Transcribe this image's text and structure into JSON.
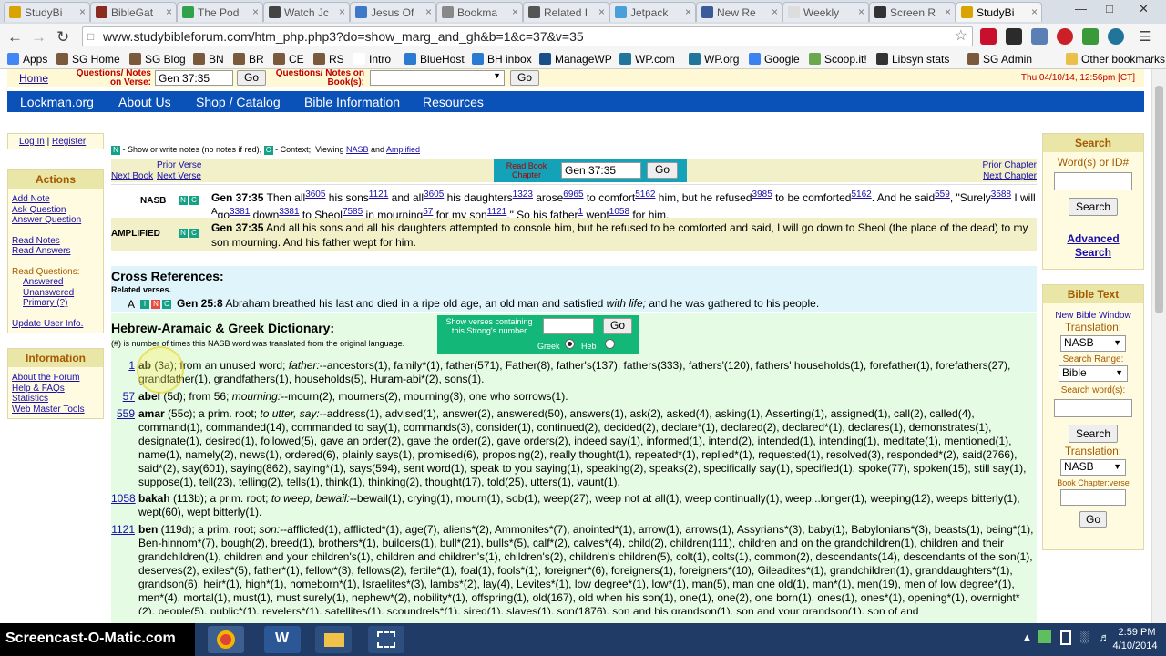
{
  "browser": {
    "tabs": [
      "StudyBi",
      "BibleGat",
      "The Pod",
      "Watch Jc",
      "Jesus Of",
      "Bookma",
      "Related I",
      "Jetpack",
      "New Re",
      "Weekly",
      "Screen R",
      "StudyBi"
    ],
    "tab_colors": [
      "#d9a400",
      "#8b2a1e",
      "#2fa24a",
      "#444444",
      "#3f78c8",
      "#888888",
      "#555555",
      "#4aa0d8",
      "#3a5a9a",
      "#dddddd",
      "#333333",
      "#d9a400"
    ],
    "url": "www.studybibleforum.com/htm_php.php3?do=show_marg_and_gh&b=1&c=37&v=35",
    "bookmarks": [
      "Apps",
      "SG Home",
      "SG Blog",
      "BN",
      "BR",
      "CE",
      "RS",
      "Intro",
      "BlueHost",
      "BH inbox",
      "ManageWP",
      "WP.com",
      "WP.org",
      "Google",
      "Scoop.it!",
      "Libsyn stats",
      "SG Admin",
      "Other bookmarks"
    ]
  },
  "topstrip": {
    "home": "Home",
    "q_notes_verse": "Questions/ Notes on Verse:",
    "verse_value": "Gen 37:35",
    "go": "Go",
    "q_notes_book": "Questions/ Notes on Book(s):",
    "datetime": "Thu 04/10/14, 12:56pm [CT]"
  },
  "nav": [
    "Lockman.org",
    "About Us",
    "Shop / Catalog",
    "Bible Information",
    "Resources"
  ],
  "login": {
    "login": "Log In",
    "sep": " | ",
    "register": "Register"
  },
  "actions": {
    "title": "Actions",
    "items": [
      "Add Note",
      "Ask Question",
      "Answer Question",
      "Read Notes",
      "Read Answers"
    ],
    "read_q": "Read Questions:",
    "sub": [
      "Answered",
      "Unanswered",
      "Primary (?)"
    ],
    "update": "Update User Info."
  },
  "information": {
    "title": "Information",
    "items": [
      "About the Forum",
      "Help & FAQs",
      "Statistics",
      "Web Master Tools"
    ]
  },
  "search": {
    "title": "Search",
    "label": "Word(s) or ID#",
    "button": "Search",
    "advanced1": "Advanced",
    "advanced2": "Search"
  },
  "bibletext": {
    "title": "Bible Text",
    "new_window": "New Bible Window",
    "translation_label": "Translation:",
    "translation": "NASB",
    "range_label": "Search Range:",
    "range": "Bible",
    "words_label": "Search word(s):",
    "search_btn": "Search",
    "translation2_label": "Translation:",
    "translation2": "NASB",
    "chapverse_label": "Book Chapter:verse",
    "go": "Go"
  },
  "legend": {
    "n": "N",
    "n_text": " - Show or write notes (no notes if red),",
    "c": "C",
    "c_text": " - Context;",
    "viewing": "Viewing ",
    "nasb": "NASB",
    "and": " and ",
    "amplified": "Amplified"
  },
  "chapnav": {
    "prior_verse": "Prior Verse",
    "next_book": "Next Book",
    "next_verse": "Next Verse",
    "read_label": "Read Book Chapter",
    "value": "Gen 37:35",
    "go": "Go",
    "prior_chapter": "Prior Chapter",
    "next_chapter": "Next Chapter"
  },
  "verses": [
    {
      "version": "NASB",
      "html": "<b>Gen 37:35</b> Then all<sup class='lnk'>3605</sup> his sons<sup class='lnk'>1121</sup> and all<sup class='lnk'>3605</sup> his daughters<sup class='lnk'>1323</sup> arose<sup class='lnk'>6965</sup> to comfort<sup class='lnk'>5162</sup> him, but he refused<sup class='lnk'>3985</sup> to be comforted<sup class='lnk'>5162</sup>. And he said<sup class='lnk'>559</sup>, \"Surely<sup class='lnk'>3588</sup> I will <sup>A</sup>go<sup class='lnk'>3381</sup> down<sup class='lnk'>3381</sup> to Sheol<sup class='lnk'>7585</sup> in mourning<sup class='lnk'>57</sup> for my son<sup class='lnk'>1121</sup>.\" So his father<sup class='lnk'>1</sup> wept<sup class='lnk'>1058</sup> for him."
    },
    {
      "version": "AMPLIFIED",
      "html": "<b>Gen 37:35</b> And all his sons and all his daughters attempted to console him, but he refused to be comforted and said, I will go down to Sheol (the place of the dead) to my son mourning. And his father wept for him."
    }
  ],
  "crossrefs": {
    "title": "Cross References:",
    "sub": "Related verses.",
    "letter": "A",
    "html": "<b>Gen 25:8</b> Abraham breathed his last and died in a ripe old age, an old man and satisfied <i>with life;</i> and he was gathered to his people."
  },
  "dictionary": {
    "title": "Hebrew-Aramaic & Greek Dictionary:",
    "sub": "(#) is number of times this NASB word was translated from the original language.",
    "show_label": "Show verses containing this Strong's number",
    "go": "Go",
    "greek": "Greek",
    "heb": "Heb",
    "entries": [
      {
        "num": "1",
        "html": "<b>ab</b> (3a); from an unused word; <i>father:</i>--ancestors(1), family*(1), father(571), Father(8), father's(137), fathers(333), fathers'(120), fathers' households(1), forefather(1), forefathers(27), grandfather(1), grandfathers(1), households(5), Huram-abi*(2), sons(1)."
      },
      {
        "num": "57",
        "html": "<b>abel</b> (5d); from 56; <i>mourning:</i>--mourn(2), mourners(2), mourning(3), one who sorrows(1)."
      },
      {
        "num": "559",
        "html": "<b>amar</b> (55c); a prim. root; <i>to utter, say:</i>--address(1), advised(1), answer(2), answered(50), answers(1), ask(2), asked(4), asking(1), Asserting(1), assigned(1), call(2), called(4), command(1), commanded(14), commanded to say(1), commands(3), consider(1), continued(2), decided(2), declare*(1), declared(2), declared*(1), declares(1), demonstrates(1), designate(1), desired(1), followed(5), gave an order(2), gave the order(2), gave orders(2), indeed say(1), informed(1), intend(2), intended(1), intending(1), meditate(1), mentioned(1), name(1), namely(2), news(1), ordered(6), plainly says(1), promised(6), proposing(2), really thought(1), repeated*(1), replied*(1), requested(1), resolved(3), responded*(2), said(2766), said*(2), say(601), saying(862), saying*(1), says(594), sent word(1), speak to you saying(1), speaking(2), speaks(2), specifically say(1), specified(1), spoke(77), spoken(15), still say(1), suppose(1), tell(23), telling(2), tells(1), think(1), thinking(2), thought(17), told(25), utters(1), vaunt(1)."
      },
      {
        "num": "1058",
        "html": "<b>bakah</b> (113b); a prim. root; <i>to weep, bewail:</i>--bewail(1), crying(1), mourn(1), sob(1), weep(27), weep not at all(1), weep continually(1), weep...longer(1), weeping(12), weeps bitterly(1), wept(60), wept bitterly(1)."
      },
      {
        "num": "1121",
        "html": "<b>ben</b> (119d); a prim. root; <i>son:</i>--afflicted(1), afflicted*(1), age(7), aliens*(2), Ammonites*(7), anointed*(1), arrow(1), arrows(1), Assyrians*(3), baby(1), Babylonians*(3), beasts(1), being*(1), Ben-hinnom*(7), bough(2), breed(1), brothers*(1), builders(1), bull*(21), bulls*(5), calf*(2), calves*(4), child(2), children(111), children and on the grandchildren(1), children and their grandchildren(1), children and your children's(1), children and children's(1), children's(2), children's children(5), colt(1), colts(1), common(2), descendants(14), descendants of the son(1), deserves(2), exiles*(5), father*(1), fellow*(3), fellows(2), fertile*(1), foal(1), fools*(1), foreigner*(6), foreigners(1), foreigners*(10), Gileadites*(1), grandchildren(1), granddaughters*(1), grandson(6), heir*(1), high*(1), homeborn*(1), Israelites*(3), lambs*(2), lay(4), Levites*(1), low degree*(1), low*(1), man(5), man one old(1), man*(1), men(19), men of low degree*(1), men*(4), mortal(1), must(1), must surely(1), nephew*(2), nobility*(1), offspring(1), old(167), old when his son(1), one(1), one(2), one born(1), ones(1), ones*(1), opening*(1), overnight*(2), people(5), public*(1), revelers*(1), satellites(1), scoundrels*(1), sired(1), slaves(1), son(1876), son and his grandson(1), son and your grandson(1), son of and"
      }
    ]
  },
  "taskbar": {
    "watermark": "Screencast-O-Matic.com",
    "time": "2:59 PM",
    "date": "4/10/2014"
  }
}
